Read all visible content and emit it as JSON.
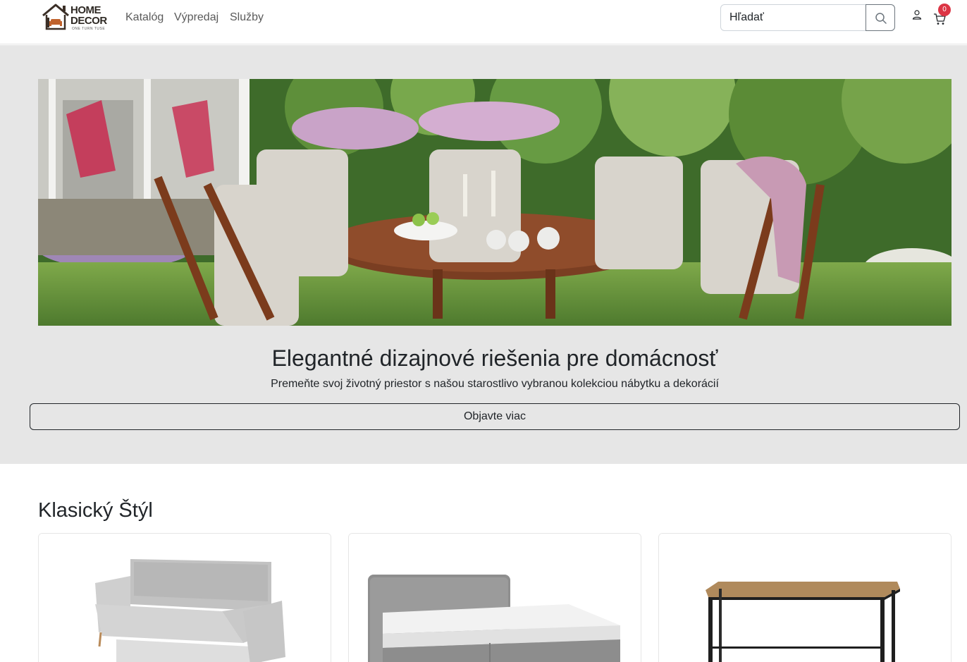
{
  "brand": {
    "line1": "HOME",
    "line2": "DECOR",
    "tagline": "ONE TURN TUSE"
  },
  "nav": {
    "items": [
      "Katalóg",
      "Výpredaj",
      "Služby"
    ]
  },
  "search": {
    "placeholder": "Hľadať"
  },
  "cart": {
    "count": "0"
  },
  "icons": {
    "search": "search-icon",
    "user": "user-icon",
    "cart": "cart-icon"
  },
  "colors": {
    "badge": "#dc3545",
    "hero_bg": "#e6e6e6"
  },
  "hero": {
    "title": "Elegantné dizajnové riešenia pre domácnosť",
    "subtitle": "Premeňte svoj životný priestor s našou starostlivo vybranou kolekciou nábytku a dekorácií",
    "button": "Objavte viac"
  },
  "section": {
    "title": "Klasický Štýl"
  }
}
